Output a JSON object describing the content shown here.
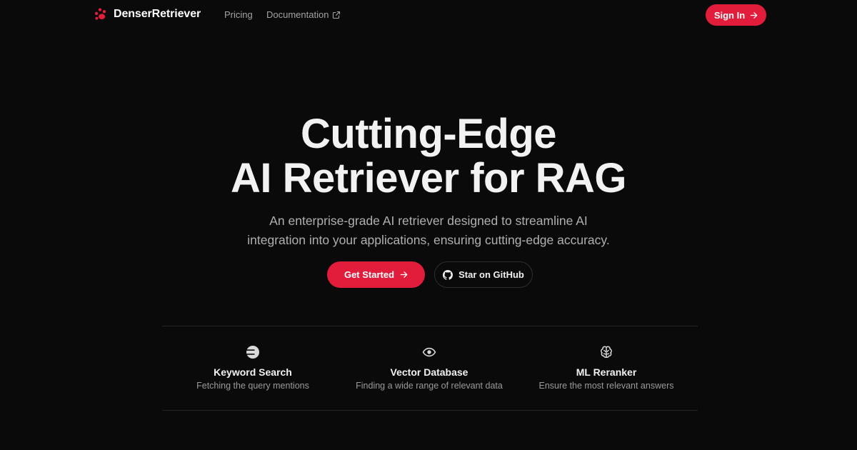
{
  "nav": {
    "brand": "DenserRetriever",
    "links": [
      {
        "label": "Pricing"
      },
      {
        "label": "Documentation"
      }
    ],
    "signin_label": "Sign In"
  },
  "hero": {
    "title_lines": [
      "Cutting-Edge",
      "AI Retriever for RAG"
    ],
    "subtitle_lines": [
      "An enterprise-grade AI retriever designed to streamline AI",
      "integration into your applications, ensuring cutting-edge accuracy."
    ],
    "cta_primary": "Get Started",
    "cta_secondary": "Star on GitHub"
  },
  "features": [
    {
      "icon": "keyword-search-icon",
      "title": "Keyword Search",
      "desc": "Fetching the query mentions"
    },
    {
      "icon": "eye-icon",
      "title": "Vector Database",
      "desc": "Finding a wide range of relevant data"
    },
    {
      "icon": "brain-icon",
      "title": "ML Reranker",
      "desc": "Ensure the most relevant answers"
    }
  ],
  "colors": {
    "background": "#0b0a0a",
    "accent": "#e11d3b",
    "text": "#f2f2f2",
    "muted": "#a3a3a3"
  }
}
